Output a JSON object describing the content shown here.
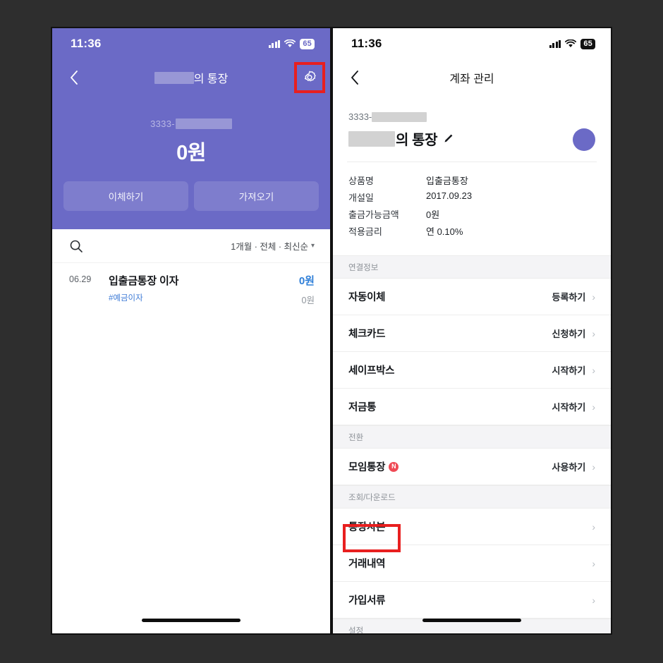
{
  "meta": {
    "accent_purple": "#6b6ac6",
    "highlight_red": "#e81f1f",
    "link_blue": "#2f7fd8",
    "badge_red": "#ef4a55",
    "page_bg": "#2e2e2e"
  },
  "left_phone": {
    "status": {
      "time": "11:36",
      "battery": "65",
      "signal_icon": "cellular-signal-icon",
      "wifi_icon": "wifi-icon"
    },
    "nav": {
      "back_icon": "chevron-left-icon",
      "title_suffix": "의 통장",
      "title_redacted": true,
      "settings_icon": "gear-icon",
      "settings_highlighted": true
    },
    "hero": {
      "account_prefix": "3333-",
      "account_redacted": true,
      "balance": "0원",
      "buttons": [
        {
          "label": "이체하기",
          "name": "transfer-button"
        },
        {
          "label": "가져오기",
          "name": "fetch-button"
        }
      ]
    },
    "transactions_bar": {
      "search_icon": "search-icon",
      "filter_text": "1개월 · 전체 · 최신순",
      "filter_chevron": "chevron-down-icon"
    },
    "transactions": [
      {
        "date": "06.29",
        "title": "입출금통장 이자",
        "tag": "#예금이자",
        "amount": "0원",
        "balance": "0원"
      }
    ]
  },
  "right_phone": {
    "status": {
      "time": "11:36",
      "battery": "65",
      "signal_icon": "cellular-signal-icon",
      "wifi_icon": "wifi-icon"
    },
    "nav": {
      "back_icon": "chevron-left-icon",
      "title": "계좌 관리"
    },
    "account": {
      "number_prefix": "3333-",
      "number_redacted": true,
      "name_suffix": "의 통장",
      "name_redacted": true,
      "edit_icon": "pencil-icon",
      "avatar": "account-avatar"
    },
    "spec": [
      {
        "key": "상품명",
        "value": "입출금통장"
      },
      {
        "key": "개설일",
        "value": "2017.09.23"
      },
      {
        "key": "출금가능금액",
        "value": "0원"
      },
      {
        "key": "적용금리",
        "value": "연 0.10%"
      }
    ],
    "sections": [
      {
        "heading": "연결정보",
        "rows": [
          {
            "label": "자동이체",
            "action": "등록하기",
            "badge": null,
            "highlighted": false
          },
          {
            "label": "체크카드",
            "action": "신청하기",
            "badge": null,
            "highlighted": false
          },
          {
            "label": "세이프박스",
            "action": "시작하기",
            "badge": null,
            "highlighted": false
          },
          {
            "label": "저금통",
            "action": "시작하기",
            "badge": null,
            "highlighted": false
          }
        ]
      },
      {
        "heading": "전환",
        "rows": [
          {
            "label": "모임통장",
            "action": "사용하기",
            "badge": "N",
            "highlighted": false
          }
        ]
      },
      {
        "heading": "조회/다운로드",
        "rows": [
          {
            "label": "통장사본",
            "action": "",
            "badge": null,
            "highlighted": true
          },
          {
            "label": "거래내역",
            "action": "",
            "badge": null,
            "highlighted": false
          },
          {
            "label": "가입서류",
            "action": "",
            "badge": null,
            "highlighted": false
          }
        ]
      },
      {
        "heading": "설정",
        "rows": []
      }
    ],
    "chevron_glyph": "›"
  }
}
